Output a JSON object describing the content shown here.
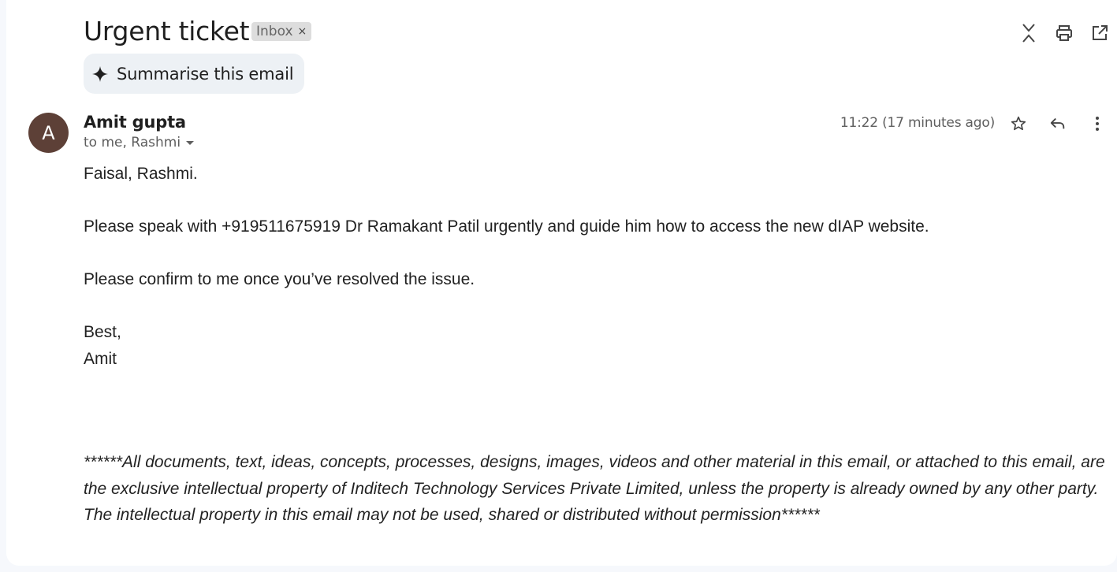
{
  "email": {
    "subject": "Urgent ticket",
    "label": "Inbox",
    "label_remove": "×",
    "summarise_label": "Summarise this email",
    "sender_initial": "A",
    "sender_name": "Amit gupta",
    "recipients": "to me, Rashmi",
    "timestamp": "11:22 (17 minutes ago)",
    "body": {
      "greeting": "Faisal, Rashmi.",
      "line1": "Please speak with +919511675919 Dr Ramakant Patil urgently and guide him how to access the new dIAP website.",
      "line2": "Please confirm to me once you’ve resolved the issue.",
      "signoff": "Best,",
      "signature": "Amit"
    },
    "disclaimer": "******All documents, text, ideas, concepts, processes, designs, images, videos and other material in this email, or attached to this email, are the exclusive intellectual property of Inditech Technology Services Private Limited, unless the property is already owned by any other party. The intellectual property in this email may not be used, shared or distributed without permission******"
  },
  "icons": {
    "collapse": "collapse-all-icon",
    "print": "print-icon",
    "open_new_window": "open-in-new-window-icon",
    "sparkle": "sparkle-icon",
    "star": "star-icon",
    "reply": "reply-icon",
    "more": "more-vert-icon",
    "dropdown": "dropdown-arrow-icon"
  },
  "colors": {
    "avatar_bg": "#5d4037",
    "summarise_bg": "#edf1f5",
    "label_bg": "#dddddd"
  }
}
